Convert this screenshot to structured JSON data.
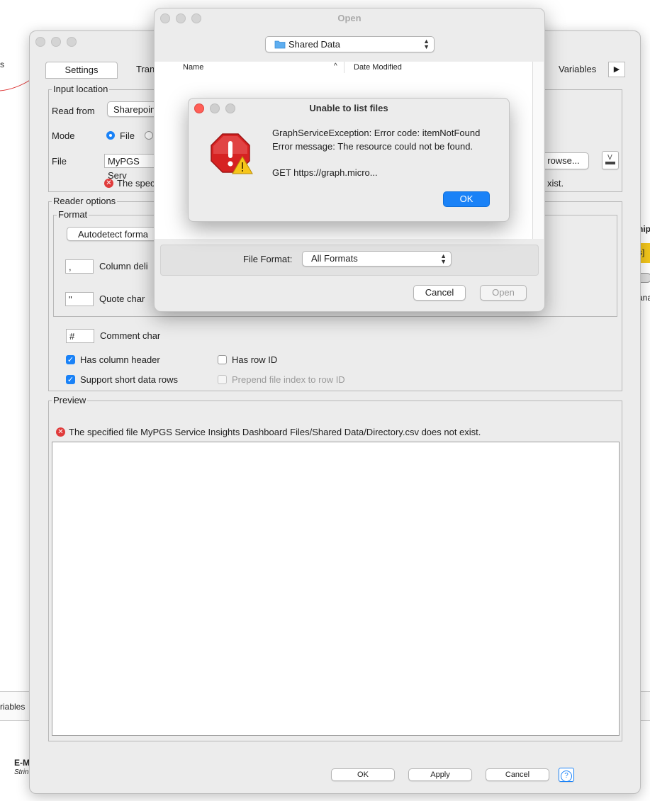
{
  "background": {
    "left_text_top": "s",
    "left_text_mid": "riables",
    "bottom_node_title": "E-M",
    "bottom_node_sub": "Strin",
    "right_text_top": "hip",
    "right_badge": "s]",
    "right_text_bottom": "ana"
  },
  "main": {
    "tabs": {
      "active": "Settings",
      "partial": "Tran",
      "right_partial": "Variables",
      "arrow": "▶"
    },
    "input_location": {
      "title": "Input location",
      "read_from_label": "Read from",
      "read_from_value": "Sharepoin",
      "mode_label": "Mode",
      "mode_file": "File",
      "file_label": "File",
      "file_value": "MyPGS Serv",
      "browse_label": "rowse...",
      "error_left": "The spec",
      "error_right": "xist."
    },
    "reader_options": {
      "title": "Reader options",
      "format_title": "Format",
      "autodetect_label": "Autodetect forma",
      "column_delim_value": ",",
      "column_delim_label": "Column deli",
      "quote_value": "\"",
      "quote_label": "Quote char",
      "comment_value": "#",
      "comment_label": "Comment char",
      "has_column_header": "Has column header",
      "has_row_id": "Has row ID",
      "support_short_rows": "Support short data rows",
      "prepend_file_index": "Prepend file index to row ID"
    },
    "preview": {
      "title": "Preview",
      "error": "The specified file MyPGS Service Insights Dashboard Files/Shared Data/Directory.csv does not exist."
    },
    "footer": {
      "ok": "OK",
      "apply": "Apply",
      "cancel": "Cancel",
      "help": "?"
    }
  },
  "open_dialog": {
    "title": "Open",
    "location": "Shared Data",
    "col_name": "Name",
    "col_date": "Date Modified",
    "file_format_label": "File Format:",
    "file_format_value": "All Formats",
    "cancel": "Cancel",
    "open": "Open"
  },
  "alert": {
    "title": "Unable to list files",
    "line1": "GraphServiceException: Error code: itemNotFound",
    "line2": "Error message: The resource could not be found.",
    "line3": "GET https://graph.micro...",
    "ok": "OK"
  }
}
